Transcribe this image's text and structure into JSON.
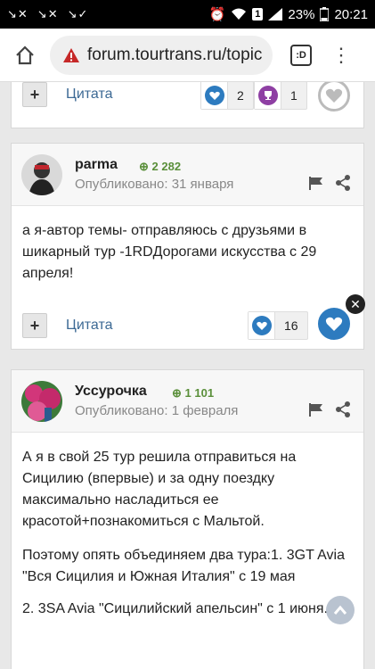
{
  "status_bar": {
    "battery": "23%",
    "time": "20:21",
    "sim": "1"
  },
  "browser": {
    "url": "forum.tourtrans.ru/topic",
    "tabs_label": ":D"
  },
  "post0": {
    "quote_label": "Цитата",
    "likes": "2",
    "trophies": "1"
  },
  "post1": {
    "author": "parma",
    "reputation": "2 282",
    "posted_label": "Опубликовано:",
    "date": "31 января",
    "body": "а я-автор темы- отправляюсь с друзьями в шикарный тур -1RDДорогами искусства с 29 апреля!",
    "quote_label": "Цитата",
    "likes": "16"
  },
  "post2": {
    "author": "Уссурочка",
    "reputation": "1 101",
    "posted_label": "Опубликовано:",
    "date": "1 февраля",
    "para1": "А я в свой 25 тур решила отправиться на Сицилию (впервые) и за одну поездку максимально насладиться ее красотой+познакомиться с Мальтой.",
    "para2": "Поэтому опять объединяем два тура:1. 3GT Avia \"Вся Сицилия и Южная Италия\" с 19 мая",
    "para3": "2. 3SA Avia \"Сицилийский апельсин\" с 1 июня."
  },
  "colors": {
    "accent": "#3c6994",
    "rep_green": "#5a8f3a",
    "heart_blue": "#2d7bbf"
  }
}
